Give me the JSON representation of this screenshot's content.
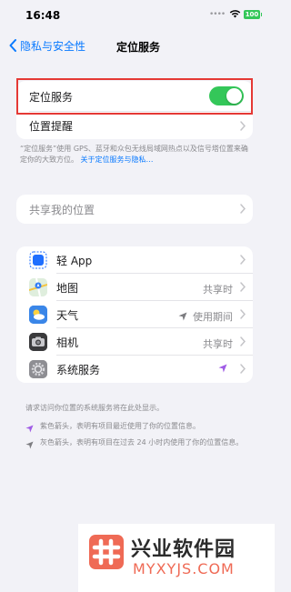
{
  "status": {
    "time": "16:48",
    "battery": "100",
    "battery_color": "#34c759"
  },
  "nav": {
    "back_label": "隐私与安全性",
    "title": "定位服务"
  },
  "location_services": {
    "label": "定位服务",
    "enabled": true
  },
  "location_alerts": {
    "label": "位置提醒"
  },
  "location_note": {
    "text": "“定位服务”使用 GPS、蓝牙和众包无线局域网热点以及信号塔位置来确定你的大致方位。",
    "link": "关于定位服务与隐私…"
  },
  "share_location": {
    "label": "共享我的位置"
  },
  "apps": [
    {
      "label": "轻 App",
      "value": "",
      "icon": "clip-app-icon"
    },
    {
      "label": "地图",
      "value": "共享时",
      "icon": "maps-icon"
    },
    {
      "label": "天气",
      "value": "使用期间",
      "icon": "weather-icon",
      "arrow": "gray"
    },
    {
      "label": "相机",
      "value": "共享时",
      "icon": "camera-icon"
    },
    {
      "label": "系统服务",
      "value": "",
      "icon": "gear-icon",
      "arrow": "purple"
    }
  ],
  "system_note": "请求访问你位置的系统服务将在此处显示。",
  "legend": [
    {
      "text": "紫色箭头，表明有项目最近使用了你的位置信息。",
      "color": "#a05ce6"
    },
    {
      "text": "灰色箭头，表明有项目在过去 24 小时内使用了你的位置信息。",
      "color": "#7c7c80"
    }
  ],
  "colors": {
    "accent": "#0a7aff",
    "toggle_on": "#34c759",
    "highlight": "#e53935"
  },
  "watermark": {
    "name": "兴业软件园",
    "domain": "MYXYJS.COM"
  }
}
